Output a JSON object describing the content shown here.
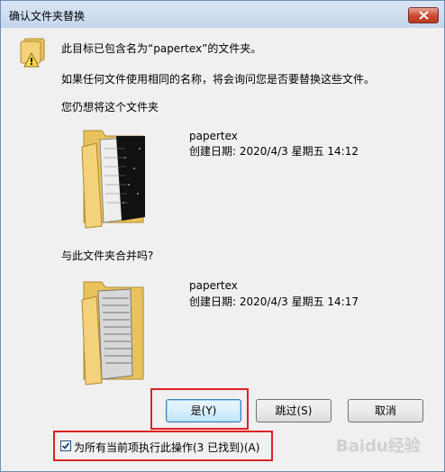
{
  "window": {
    "title": "确认文件夹替换"
  },
  "message": {
    "line1": "此目标已包含名为“papertex”的文件夹。",
    "line2": "如果任何文件使用相同的名称，将会询问您是否要替换这些文件。",
    "line3": "您仍想将这个文件夹"
  },
  "target_folder": {
    "name": "papertex",
    "created": "创建日期: 2020/4/3 星期五 14:12"
  },
  "merge_prompt": "与此文件夹合并吗?",
  "source_folder": {
    "name": "papertex",
    "created": "创建日期: 2020/4/3 星期五 14:17"
  },
  "buttons": {
    "yes": "是(Y)",
    "skip": "跳过(S)",
    "cancel": "取消"
  },
  "checkbox": {
    "label": "为所有当前项执行此操作(3 已找到)(A)",
    "checked": true
  },
  "watermark": "Baidu经验",
  "colors": {
    "highlight": "#e02020",
    "folder": "#f3d27a"
  }
}
